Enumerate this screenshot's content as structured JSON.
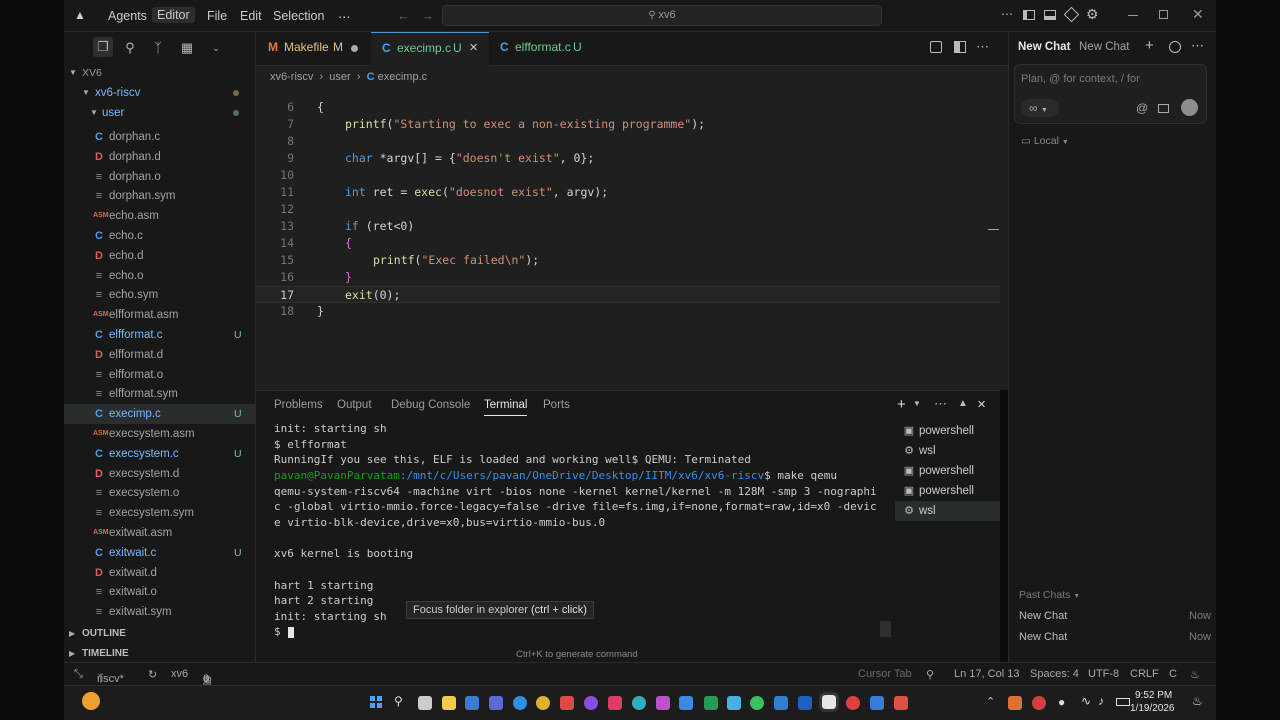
{
  "titlebar": {
    "menus": [
      "Agents",
      "Editor",
      "File",
      "Edit",
      "Selection",
      "⋯"
    ],
    "search": "xv6"
  },
  "explorer": {
    "root": "XV6",
    "folder": "xv6-riscv",
    "subfolder": "user",
    "files": [
      {
        "type": "c",
        "name": "dorphan.c",
        "badge": ""
      },
      {
        "type": "d",
        "name": "dorphan.d",
        "badge": ""
      },
      {
        "type": "eq",
        "name": "dorphan.o",
        "badge": ""
      },
      {
        "type": "eq",
        "name": "dorphan.sym",
        "badge": ""
      },
      {
        "type": "asm",
        "name": "echo.asm",
        "badge": ""
      },
      {
        "type": "c",
        "name": "echo.c",
        "badge": ""
      },
      {
        "type": "d",
        "name": "echo.d",
        "badge": ""
      },
      {
        "type": "eq",
        "name": "echo.o",
        "badge": ""
      },
      {
        "type": "eq",
        "name": "echo.sym",
        "badge": ""
      },
      {
        "type": "asm",
        "name": "elfformat.asm",
        "badge": ""
      },
      {
        "type": "c",
        "name": "elfformat.c",
        "badge": "U"
      },
      {
        "type": "d",
        "name": "elfformat.d",
        "badge": ""
      },
      {
        "type": "eq",
        "name": "elfformat.o",
        "badge": ""
      },
      {
        "type": "eq",
        "name": "elfformat.sym",
        "badge": ""
      },
      {
        "type": "c",
        "name": "execimp.c",
        "badge": "U"
      },
      {
        "type": "asm",
        "name": "execsystem.asm",
        "badge": ""
      },
      {
        "type": "c",
        "name": "execsystem.c",
        "badge": "U"
      },
      {
        "type": "d",
        "name": "execsystem.d",
        "badge": ""
      },
      {
        "type": "eq",
        "name": "execsystem.o",
        "badge": ""
      },
      {
        "type": "eq",
        "name": "execsystem.sym",
        "badge": ""
      },
      {
        "type": "asm",
        "name": "exitwait.asm",
        "badge": ""
      },
      {
        "type": "c",
        "name": "exitwait.c",
        "badge": "U"
      },
      {
        "type": "d",
        "name": "exitwait.d",
        "badge": ""
      },
      {
        "type": "eq",
        "name": "exitwait.o",
        "badge": ""
      },
      {
        "type": "eq",
        "name": "exitwait.sym",
        "badge": ""
      }
    ],
    "outline": "OUTLINE",
    "timeline": "TIMELINE"
  },
  "tabs": [
    {
      "icon": "M",
      "label": "Makefile",
      "badge": "M"
    },
    {
      "icon": "C",
      "label": "execimp.c",
      "badge": "U"
    },
    {
      "icon": "C",
      "label": "elfformat.c",
      "badge": "U"
    }
  ],
  "breadcrumb": {
    "a": "xv6-riscv",
    "b": "user",
    "c": "execimp.c"
  },
  "code": {
    "line_numbers": [
      "6",
      "7",
      "8",
      "9",
      "10",
      "11",
      "12",
      "13",
      "14",
      "15",
      "16",
      "17",
      "18"
    ],
    "l6": "{",
    "l7_fn": "printf",
    "l7_str": "\"Starting to exec a non-existing programme\"",
    "l9_kw": "char",
    "l9_rest": " *argv[] = {",
    "l9_str": "\"doesn't exist\"",
    "l9_tail": ", 0};",
    "l11_kw": "int",
    "l11_rest": " ret = ",
    "l11_fn": "exec",
    "l11_str": "\"doesnot exist\"",
    "l11_tail": ", argv);",
    "l13_kw": "if",
    "l13_rest": " (ret<0)",
    "l14": "{",
    "l15_fn": "printf",
    "l15_str": "\"Exec failed\\n\"",
    "l16": "}",
    "l17_fn": "exit",
    "l17_rest": "(0);",
    "l18": "}"
  },
  "panel": {
    "tabs": [
      "Problems",
      "Output",
      "Debug Console",
      "Terminal",
      "Ports"
    ],
    "terminal_lines": [
      "init: starting sh",
      "$ elfformat",
      "RunningIf you see this, ELF is loaded and working well$ QEMU: Terminated",
      "",
      "qemu-system-riscv64 -machine virt -bios none -kernel kernel/kernel -m 128M -smp 3 -nographi",
      "c -global virtio-mmio.force-legacy=false -drive file=fs.img,if=none,format=raw,id=x0 -devic",
      "e virtio-blk-device,drive=x0,bus=virtio-mmio-bus.0",
      "",
      "xv6 kernel is booting",
      "",
      "hart 1 starting",
      "hart 2 starting",
      "init: starting sh",
      "$ "
    ],
    "prompt_user": "pavan@PavanParvatam",
    "prompt_path": ":/mnt/c/Users/pavan/OneDrive/Desktop/IITM/xv6/xv6-riscv",
    "prompt_cmd": "$ make qemu",
    "terminals": [
      "powershell",
      "wsl",
      "powershell",
      "powershell",
      "wsl"
    ],
    "tooltip_text": "Focus folder in explorer",
    "tooltip_hint": "(ctrl + click)",
    "hint": "Ctrl+K to generate command"
  },
  "chat": {
    "tabs": [
      "New Chat",
      "New Chat"
    ],
    "placeholder": "Plan, @ for context, / for",
    "infinity": "∞",
    "mode": "Local",
    "past_title": "Past Chats",
    "past": [
      {
        "title": "New Chat",
        "time": "Now"
      },
      {
        "title": "New Chat",
        "time": "Now"
      }
    ]
  },
  "status": {
    "branch": "riscv*",
    "repo": "xv6",
    "errors": "0",
    "warnings": "0",
    "cursor_tab": "Cursor Tab",
    "position": "Ln 17, Col 13",
    "spaces": "Spaces: 4",
    "encoding": "UTF-8",
    "eol": "CRLF",
    "lang": "C"
  },
  "taskbar": {
    "time": "9:52 PM",
    "date": "1/19/2026"
  },
  "colors": {
    "accent": "#4e94ce",
    "green": "#13a10e",
    "blue": "#3b8eea"
  }
}
